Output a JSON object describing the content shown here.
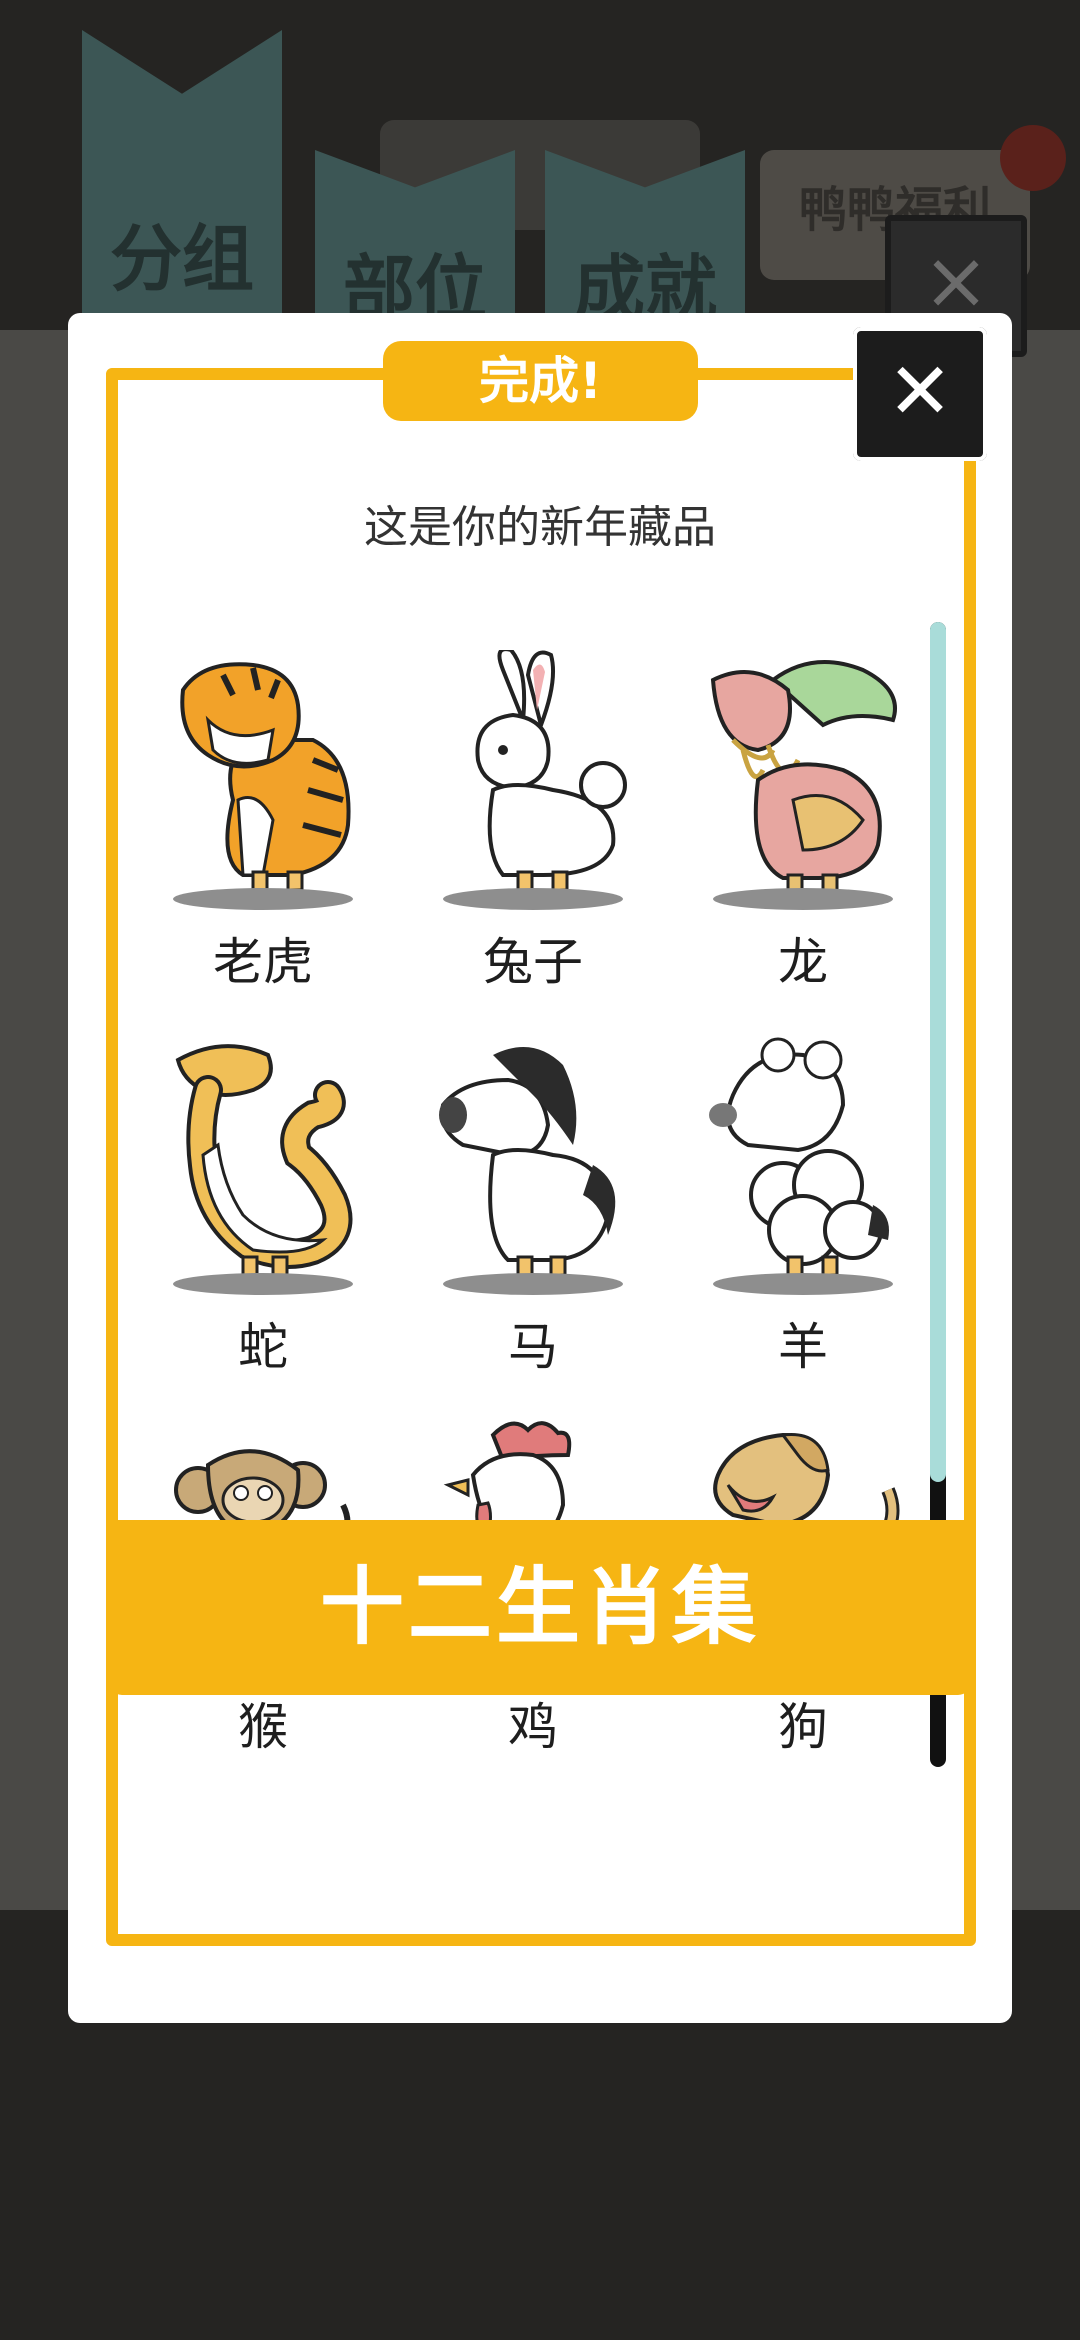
{
  "background": {
    "tabs": [
      "分组",
      "部位",
      "成就"
    ],
    "welfare_label": "鸭鸭福利"
  },
  "modal": {
    "badge": "完成!",
    "close_symbol": "✕",
    "subtitle": "这是你的新年藏品",
    "footer": "十二生肖集",
    "accent_color": "#f6b513"
  },
  "collection": [
    {
      "name": "老虎",
      "icon": "tiger-icon"
    },
    {
      "name": "兔子",
      "icon": "rabbit-icon"
    },
    {
      "name": "龙",
      "icon": "dragon-icon"
    },
    {
      "name": "蛇",
      "icon": "snake-icon"
    },
    {
      "name": "马",
      "icon": "horse-icon"
    },
    {
      "name": "羊",
      "icon": "sheep-icon"
    },
    {
      "name": "猴",
      "icon": "monkey-icon"
    },
    {
      "name": "鸡",
      "icon": "rooster-icon"
    },
    {
      "name": "狗",
      "icon": "dog-icon"
    }
  ]
}
